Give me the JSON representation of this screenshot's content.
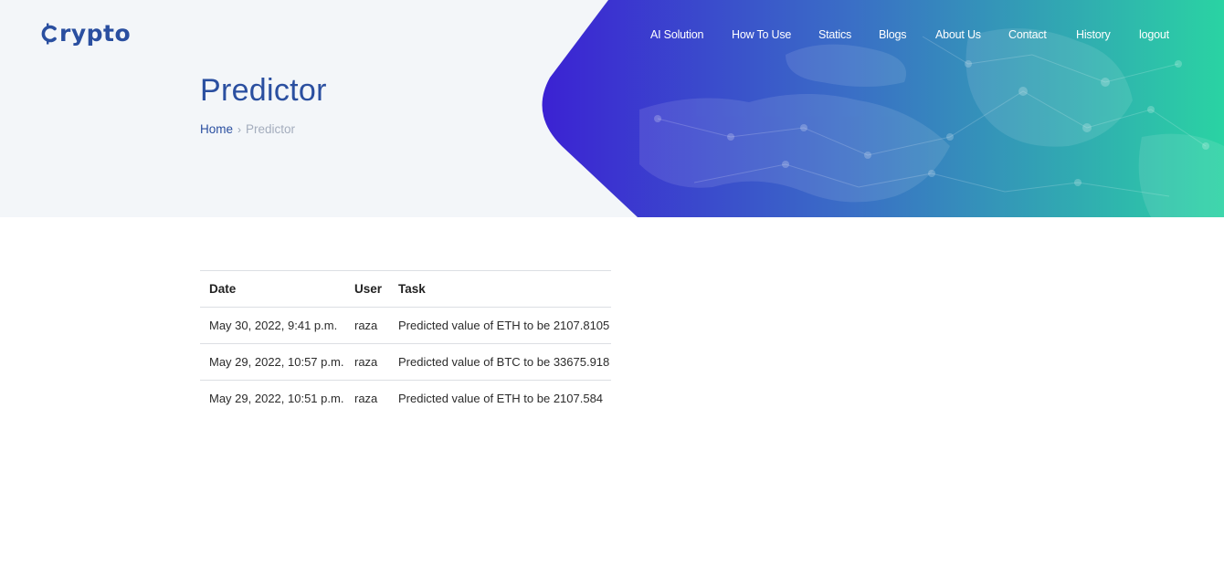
{
  "brand": {
    "logo_text": "rypto"
  },
  "nav": {
    "items": [
      {
        "label": "AI Solution"
      },
      {
        "label": "How To Use"
      },
      {
        "label": "Statics"
      },
      {
        "label": "Blogs"
      },
      {
        "label": "About Us"
      },
      {
        "label": "Contact"
      },
      {
        "label": "History"
      },
      {
        "label": "logout"
      }
    ]
  },
  "header": {
    "title": "Predictor",
    "breadcrumb": {
      "home": "Home",
      "separator": "›",
      "current": "Predictor"
    }
  },
  "table": {
    "columns": [
      "Date",
      "User",
      "Task"
    ],
    "rows": [
      {
        "date": "May 30, 2022, 9:41 p.m.",
        "user": "raza",
        "task": "Predicted value of ETH to be 2107.8105"
      },
      {
        "date": "May 29, 2022, 10:57 p.m.",
        "user": "raza",
        "task": "Predicted value of BTC to be 33675.918"
      },
      {
        "date": "May 29, 2022, 10:51 p.m.",
        "user": "raza",
        "task": "Predicted value of ETH to be 2107.584"
      }
    ]
  },
  "colors": {
    "brand": "#2a4fa0",
    "gradient_start": "#3b2bd1",
    "gradient_end": "#2ad3a3",
    "hero_bg": "#f3f6f9"
  },
  "icons": {
    "logo_mark": "bitcoin-c-icon",
    "breadcrumb_separator": "chevron-right-icon"
  }
}
